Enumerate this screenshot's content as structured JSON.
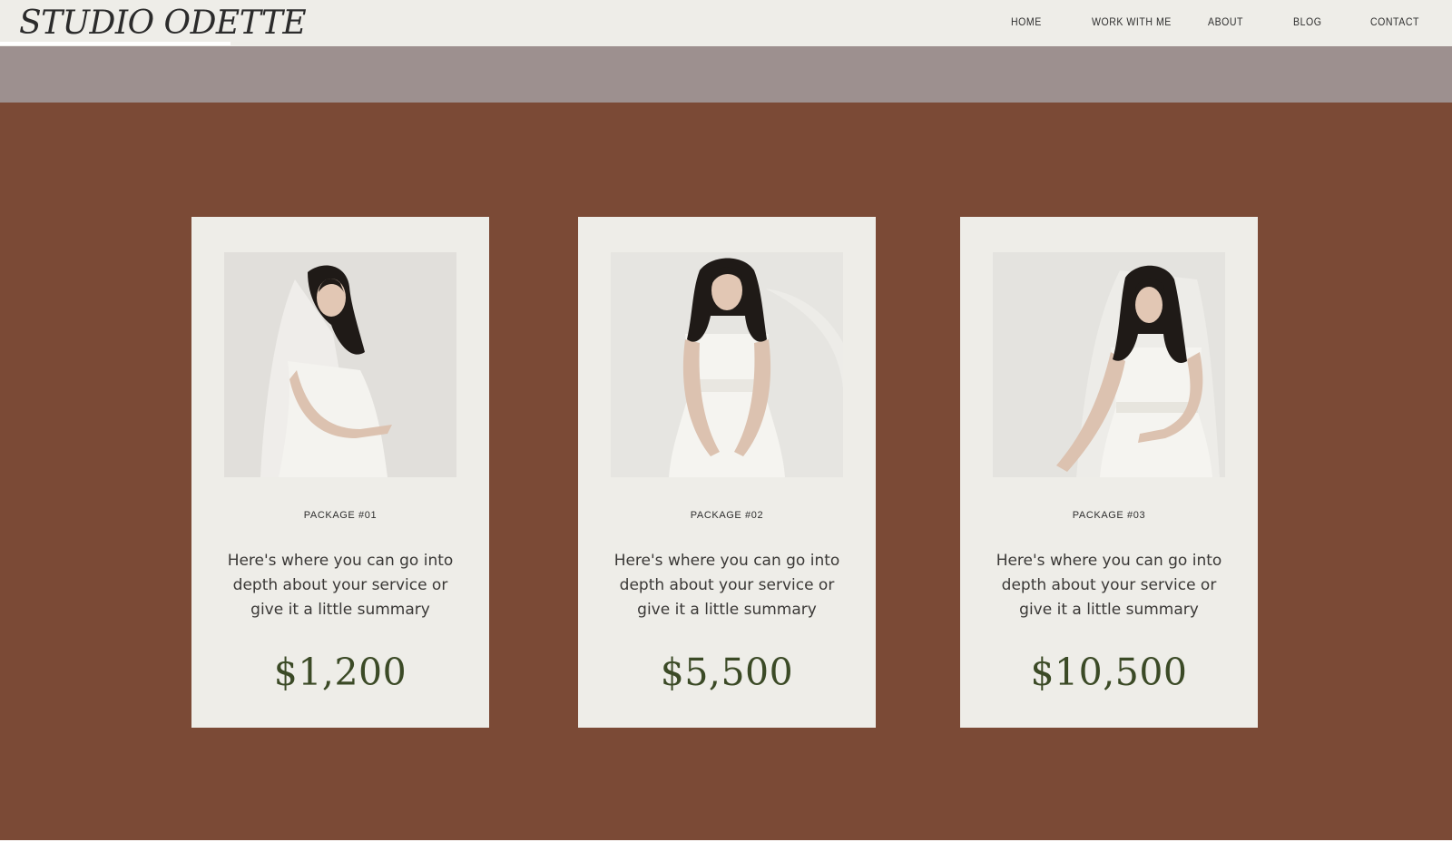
{
  "brand": {
    "logo_text": "STUDIO ODETTE"
  },
  "nav": {
    "items": [
      {
        "label": "HOME"
      },
      {
        "label": "WORK WITH ME"
      },
      {
        "label": "ABOUT"
      },
      {
        "label": "BLOG"
      },
      {
        "label": "CONTACT"
      }
    ]
  },
  "colors": {
    "header_bg": "#eeede8",
    "band_bg": "#9d908f",
    "section_bg": "#7b4a36",
    "card_bg": "#eeede8",
    "price_color": "#3b4a26"
  },
  "packages": [
    {
      "label": "PACKAGE #01",
      "description": "Here's where you can go into depth about your service or give it a little summary",
      "price": "$1,200",
      "photo_icon": "bride-with-veil-photo"
    },
    {
      "label": "PACKAGE #02",
      "description": "Here's where you can go into depth about your service or give it a little summary",
      "price": "$5,500",
      "photo_icon": "bride-portrait-photo"
    },
    {
      "label": "PACKAGE #03",
      "description": "Here's where you can go into depth about your service or give it a little summary",
      "price": "$10,500",
      "photo_icon": "bride-looking-down-photo"
    }
  ]
}
